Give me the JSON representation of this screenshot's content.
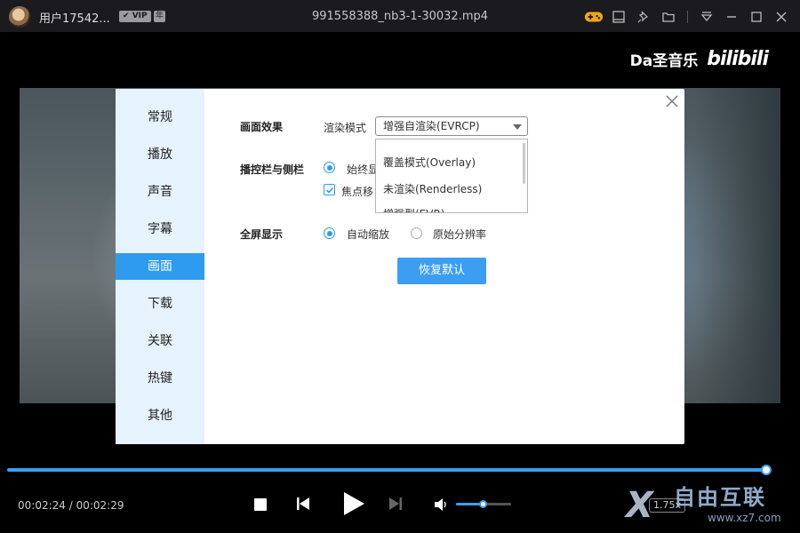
{
  "titlebar": {
    "username": "用户17542...",
    "vip_label": "VIP",
    "year_label": "年",
    "file_title": "991558388_nb3-1-30032.mp4"
  },
  "watermark": {
    "text": "Da圣音乐",
    "logo": "bilibili"
  },
  "settings": {
    "sidebar": [
      {
        "label": "常规",
        "active": false
      },
      {
        "label": "播放",
        "active": false
      },
      {
        "label": "声音",
        "active": false
      },
      {
        "label": "字幕",
        "active": false
      },
      {
        "label": "画面",
        "active": true
      },
      {
        "label": "下载",
        "active": false
      },
      {
        "label": "关联",
        "active": false
      },
      {
        "label": "热键",
        "active": false
      },
      {
        "label": "其他",
        "active": false
      }
    ],
    "picture_effect": {
      "label": "画面效果",
      "render_mode_label": "渲染模式",
      "render_mode_value": "增强自渲染(EVRCP)",
      "dropdown_options": [
        "覆盖模式(Overlay)",
        "未渲染(Renderless)",
        "增强型(EVR)"
      ]
    },
    "control_bar": {
      "label": "播控栏与侧栏",
      "option1": "始终显",
      "option2": "焦点移"
    },
    "fullscreen": {
      "label": "全屏显示",
      "option_auto": "自动缩放",
      "option_original": "原始分辨率",
      "selected": "自动缩放"
    },
    "restore_button": "恢复默认"
  },
  "player": {
    "current_time": "00:02:24",
    "separator": "/",
    "total_time": "00:02:29",
    "progress_fraction": 0.966,
    "volume_fraction": 0.5,
    "speed_label": "1.75x"
  },
  "site_watermark": {
    "big": "自由互联",
    "small": "www.xz7.com"
  },
  "colors": {
    "accent": "#3b9ef3",
    "sidebar_bg": "#e6f2fc",
    "titlebar_bg": "#1b1b1f"
  }
}
